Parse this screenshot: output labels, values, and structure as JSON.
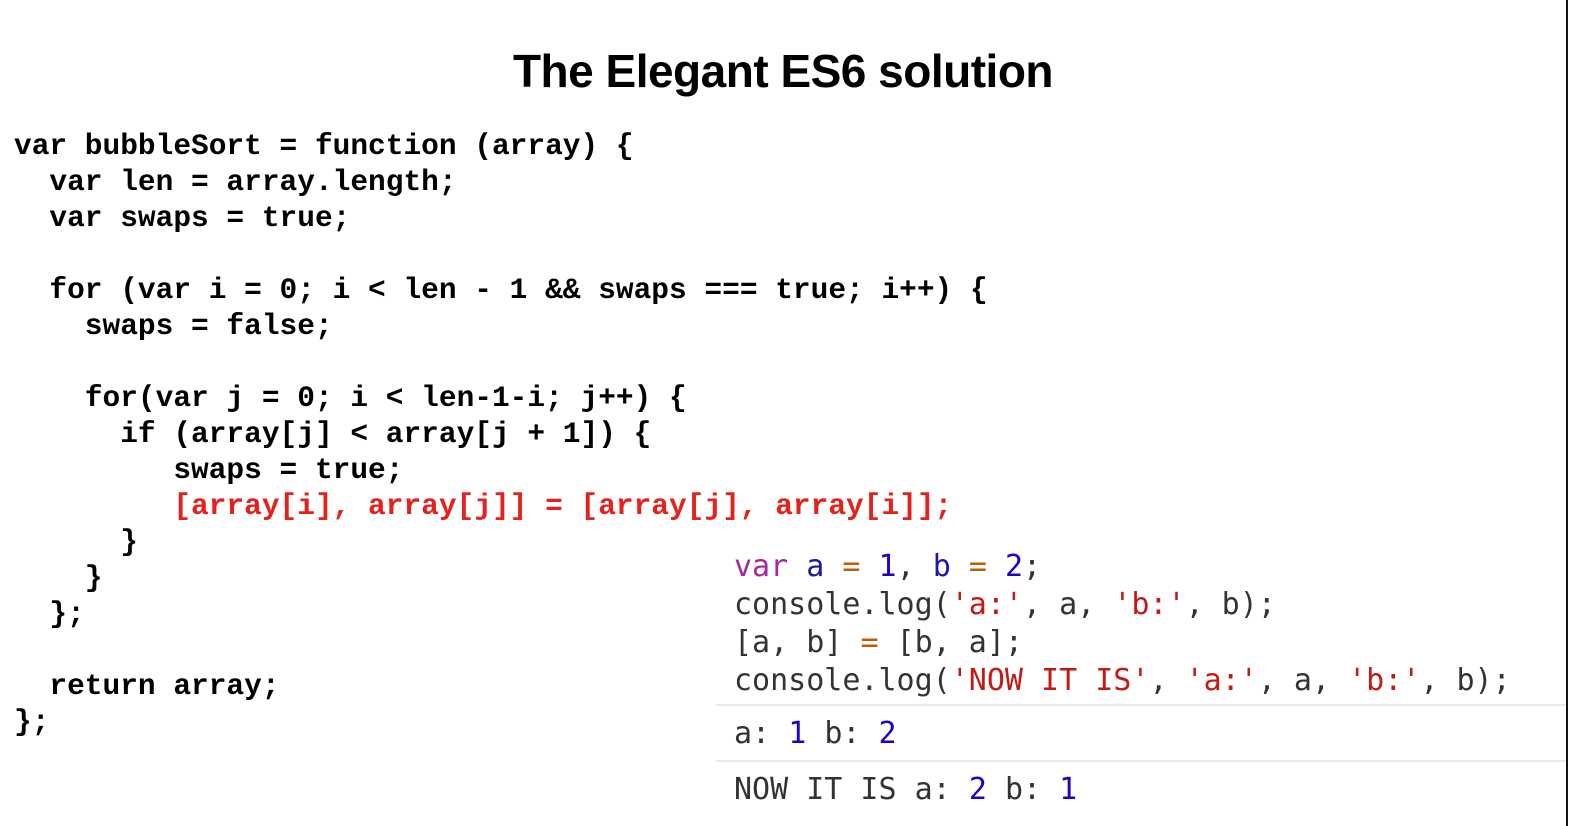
{
  "title": "The Elegant ES6 solution",
  "code_lines": [
    "var bubbleSort = function (array) {",
    "  var len = array.length;",
    "  var swaps = true;",
    "",
    "  for (var i = 0; i < len - 1 && swaps === true; i++) {",
    "    swaps = false;",
    "",
    "    for(var j = 0; i < len-1-i; j++) {",
    "      if (array[j] < array[j + 1]) {",
    "         swaps = true;",
    "         [array[i], array[j]] = [array[j], array[i]];",
    "      }",
    "    }",
    "  };",
    "",
    "  return array;",
    "};"
  ],
  "highlight_color": "#e6211c",
  "console": {
    "input": {
      "l1": {
        "kw": "var",
        "a": "a",
        "eq1": "=",
        "n1": "1",
        "comma": ",",
        "b": "b",
        "eq2": "=",
        "n2": "2",
        "semi": ";"
      },
      "l2": {
        "pre": "console.log(",
        "s1": "'a:'",
        "mid1": ", a, ",
        "s2": "'b:'",
        "post": ", b);"
      },
      "l3": {
        "pre": "[a, b] ",
        "eq": "=",
        "post": " [b, a];"
      },
      "l4": {
        "pre": "console.log(",
        "s1": "'NOW IT IS'",
        "c1": ", ",
        "s2": "'a:'",
        "mid": ", a, ",
        "s3": "'b:'",
        "post": ", b);"
      }
    },
    "output": {
      "o1": {
        "la": "a:",
        "va": "1",
        "lb": "b:",
        "vb": "2"
      },
      "o2": {
        "pre": "NOW IT IS a:",
        "va": "2",
        "lb": "b:",
        "vb": "1"
      }
    }
  }
}
